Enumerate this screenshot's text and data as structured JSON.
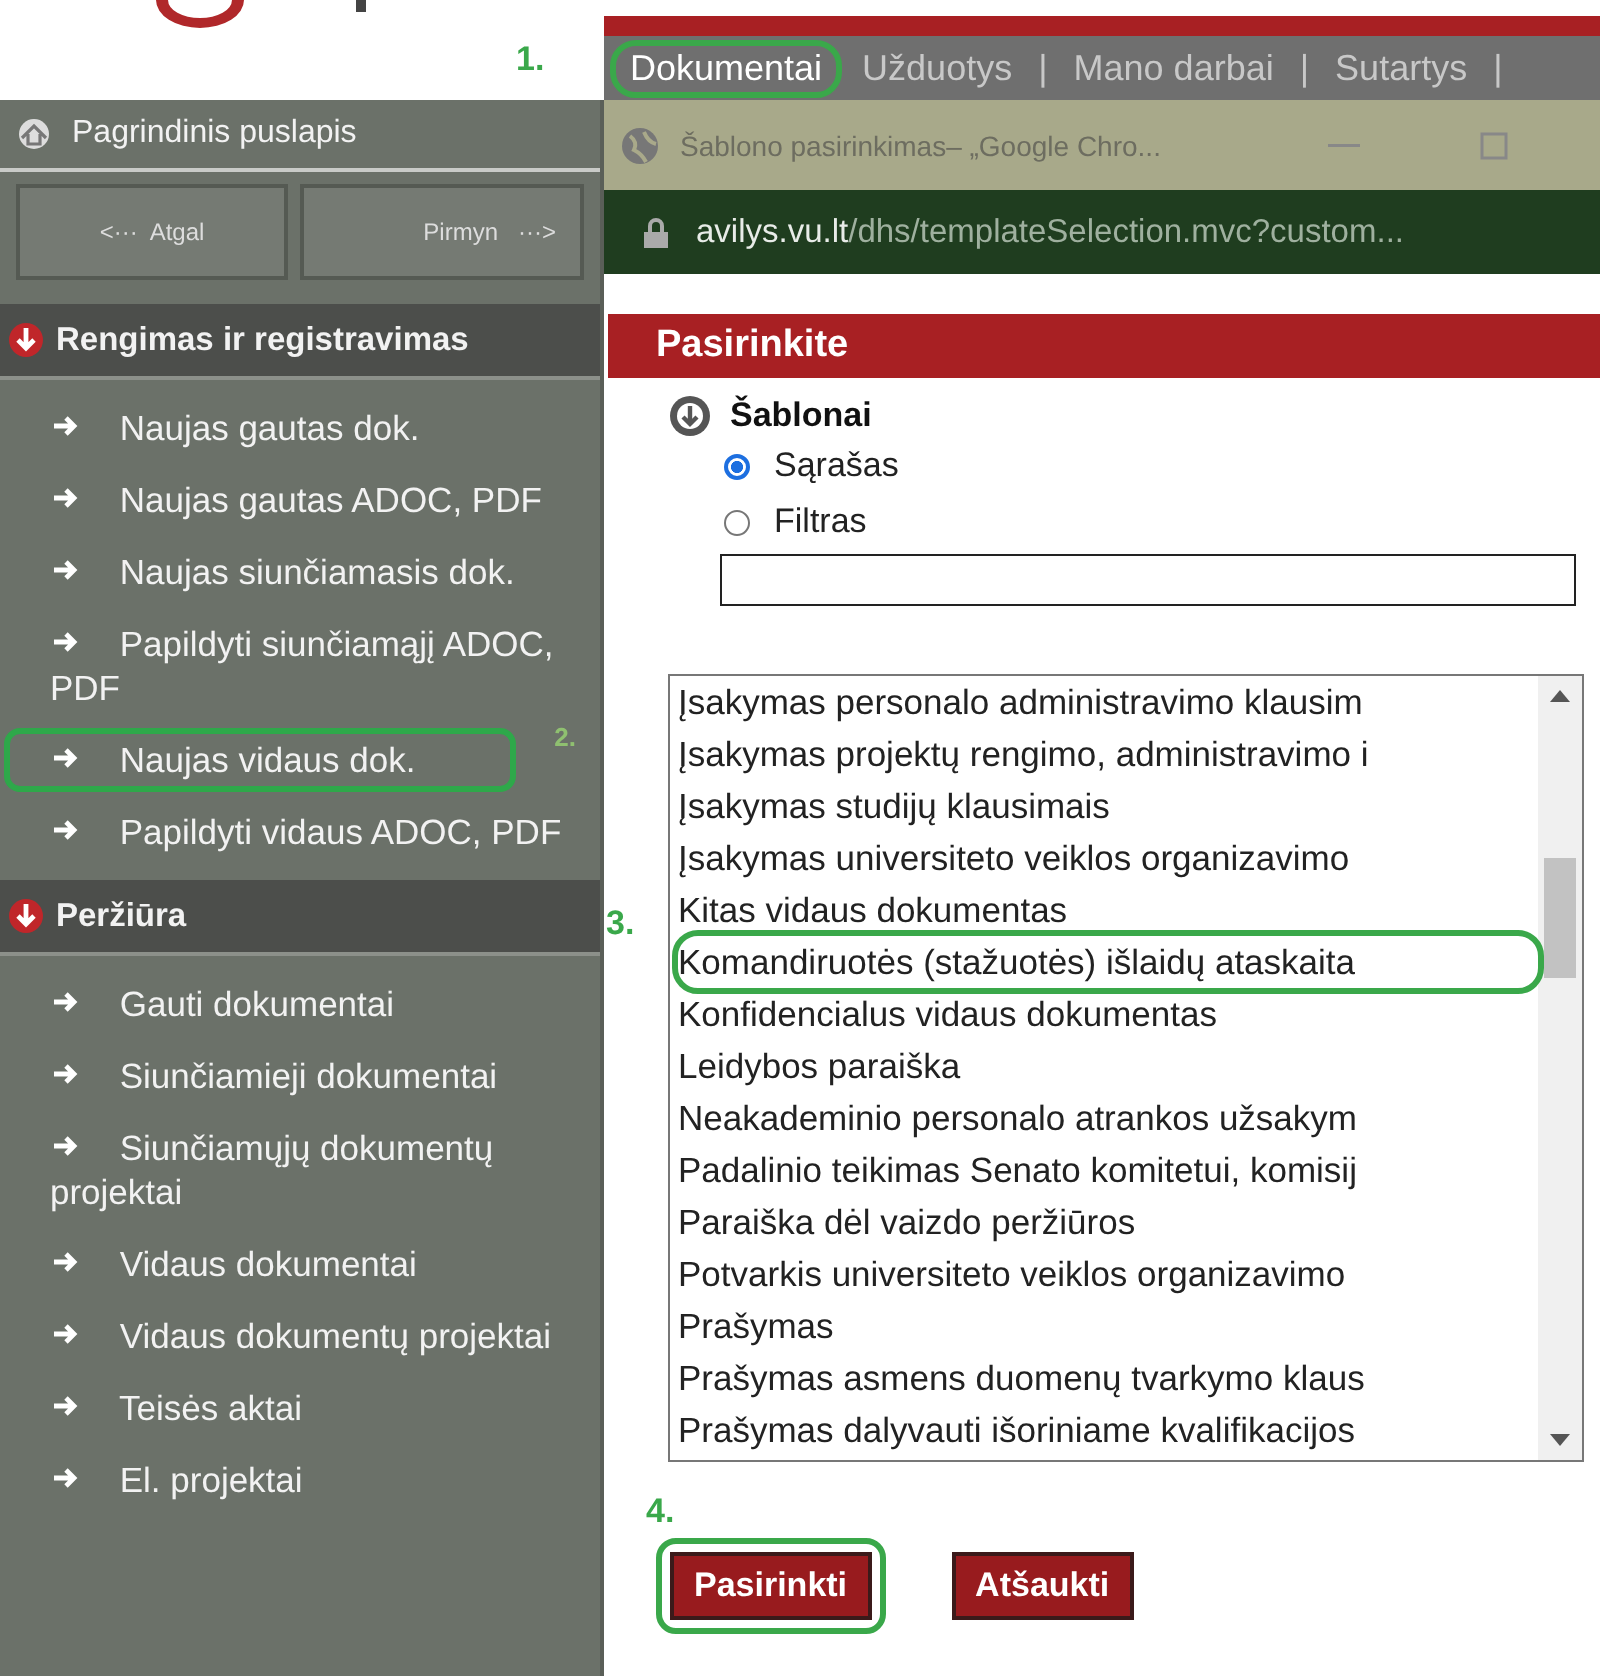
{
  "header": {
    "step": "1."
  },
  "top_nav": {
    "separator": "|",
    "tabs": [
      {
        "label": "Dokumentai",
        "selected": true,
        "highlighted": true
      },
      {
        "label": "Užduotys",
        "selected": false,
        "highlighted": false
      },
      {
        "label": "Mano darbai",
        "selected": false,
        "highlighted": false
      },
      {
        "label": "Sutartys",
        "selected": false,
        "highlighted": false
      }
    ]
  },
  "sidebar": {
    "home": "Pagrindinis puslapis",
    "back": {
      "arrow": "<···",
      "label": "Atgal"
    },
    "forward": {
      "label": "Pirmyn",
      "arrow": "···>"
    },
    "sections": [
      {
        "title": "Rengimas ir registravimas",
        "items": [
          {
            "label": "Naujas gautas dok.",
            "highlighted": false
          },
          {
            "label": "Naujas gautas ADOC, PDF",
            "highlighted": false
          },
          {
            "label": "Naujas siunčiamasis dok.",
            "highlighted": false
          },
          {
            "label": "Papildyti siunčiamąjį ADOC, PDF",
            "highlighted": false
          },
          {
            "label": "Naujas vidaus dok.",
            "highlighted": true,
            "step": "2."
          },
          {
            "label": "Papildyti vidaus ADOC, PDF",
            "highlighted": false
          }
        ]
      },
      {
        "title": "Peržiūra",
        "items": [
          {
            "label": "Gauti dokumentai",
            "highlighted": false
          },
          {
            "label": "Siunčiamieji dokumentai",
            "highlighted": false
          },
          {
            "label": "Siunčiamųjų dokumentų projektai",
            "highlighted": false
          },
          {
            "label": "Vidaus dokumentai",
            "highlighted": false
          },
          {
            "label": "Vidaus dokumentų projektai",
            "highlighted": false
          },
          {
            "label": "Teisės aktai",
            "highlighted": false
          },
          {
            "label": "El. projektai",
            "highlighted": false
          }
        ]
      }
    ]
  },
  "popup": {
    "window_title": "Šablono pasirinkimas– „Google Chro...",
    "address": {
      "domain": "avilys.vu.lt",
      "path": "/dhs/templateSelection.mvc?custom..."
    },
    "heading": "Pasirinkite",
    "section": "Šablonai",
    "modes": [
      {
        "label": "Sąrašas",
        "selected": true
      },
      {
        "label": "Filtras",
        "selected": false
      }
    ],
    "templates": [
      {
        "label": "Įsakymas personalo administravimo klausim",
        "highlighted": false
      },
      {
        "label": "Įsakymas projektų rengimo, administravimo i",
        "highlighted": false
      },
      {
        "label": "Įsakymas studijų klausimais",
        "highlighted": false
      },
      {
        "label": "Įsakymas universiteto veiklos organizavimo",
        "highlighted": false
      },
      {
        "label": "Kitas vidaus dokumentas",
        "highlighted": false
      },
      {
        "label": "Komandiruotės (stažuotės) išlaidų ataskaita",
        "highlighted": true,
        "step": "3."
      },
      {
        "label": "Konfidencialus vidaus dokumentas",
        "highlighted": false
      },
      {
        "label": "Leidybos paraiška",
        "highlighted": false
      },
      {
        "label": "Neakademinio personalo atrankos užsakym",
        "highlighted": false
      },
      {
        "label": "Padalinio teikimas Senato komitetui, komisij",
        "highlighted": false
      },
      {
        "label": "Paraiška dėl vaizdo peržiūros",
        "highlighted": false
      },
      {
        "label": "Potvarkis universiteto veiklos organizavimo",
        "highlighted": false
      },
      {
        "label": "Prašymas",
        "highlighted": false
      },
      {
        "label": "Prašymas asmens duomenų tvarkymo klaus",
        "highlighted": false
      },
      {
        "label": "Prašymas dalyvauti išoriniame kvalifikacijos",
        "highlighted": false
      }
    ],
    "buttons": [
      {
        "label": "Pasirinkti",
        "highlighted": true,
        "step": "4."
      },
      {
        "label": "Atšaukti",
        "highlighted": false
      }
    ]
  }
}
